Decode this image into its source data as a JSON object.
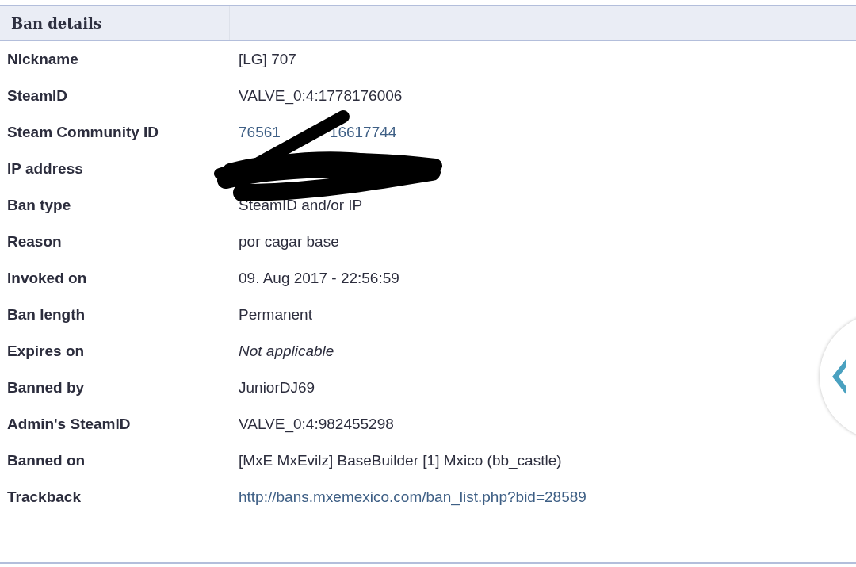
{
  "panel": {
    "title": "Ban details"
  },
  "rows": [
    {
      "label": "Nickname",
      "kind": "text",
      "value": "[LG] 707"
    },
    {
      "label": "SteamID",
      "kind": "text",
      "value": "VALVE_0:4:1778176006"
    },
    {
      "label": "Steam Community ID",
      "kind": "split_link",
      "parts": [
        "76561",
        "16617744"
      ]
    },
    {
      "label": "IP address",
      "kind": "hidden"
    },
    {
      "label": "Ban type",
      "kind": "text",
      "value": "SteamID and/or IP"
    },
    {
      "label": "Reason",
      "kind": "text",
      "value": "por cagar base"
    },
    {
      "label": "Invoked on",
      "kind": "text",
      "value": "09. Aug 2017 - 22:56:59"
    },
    {
      "label": "Ban length",
      "kind": "text",
      "value": "Permanent"
    },
    {
      "label": "Expires on",
      "kind": "italic",
      "value": "Not applicable"
    },
    {
      "label": "Banned by",
      "kind": "text",
      "value": "JuniorDJ69"
    },
    {
      "label": "Admin's SteamID",
      "kind": "text",
      "value": "VALVE_0:4:982455298"
    },
    {
      "label": "Banned on",
      "kind": "text",
      "value": "[MxE MxEvilz] BaseBuilder [1] Mxico (bb_castle)"
    },
    {
      "label": "Trackback",
      "kind": "link",
      "value": "http://bans.mxemexico.com/ban_list.php?bid=28589"
    }
  ]
}
